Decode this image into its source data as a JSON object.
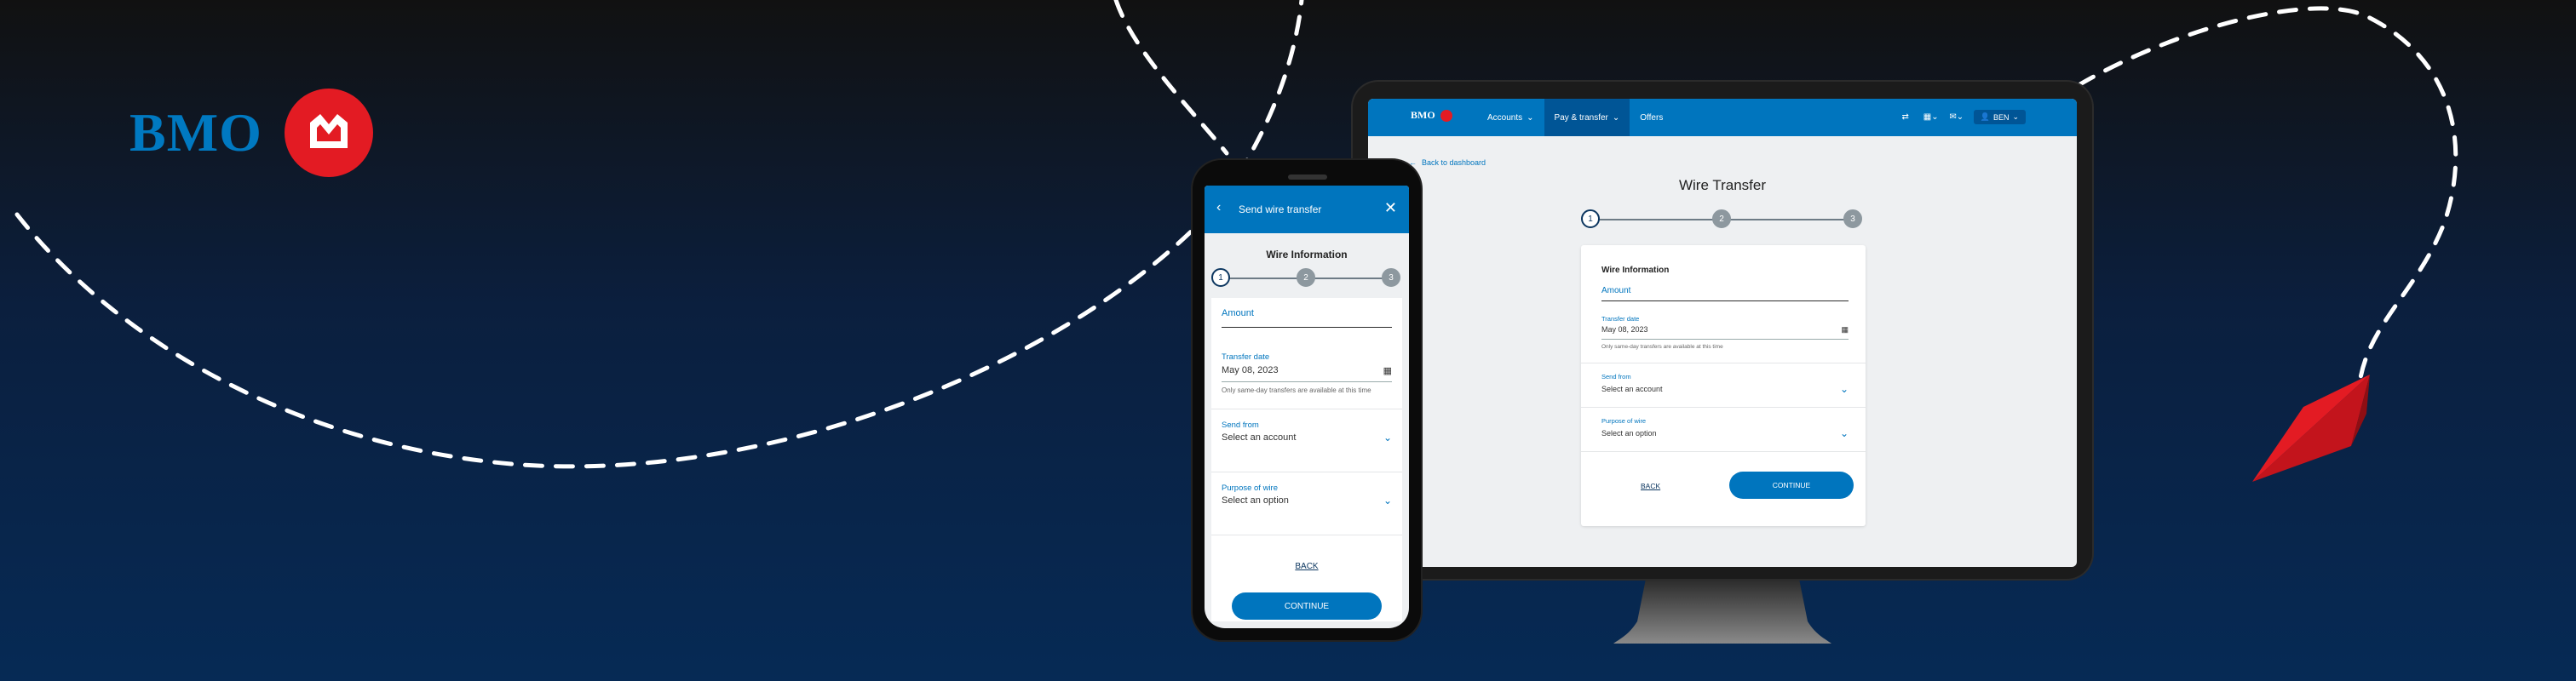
{
  "brand": {
    "name": "BMO",
    "color": "#0079c1",
    "roundel_color": "#e31b23"
  },
  "colors": {
    "primary": "#0075be",
    "nav_active": "#005596",
    "accent_red": "#e31b23",
    "step_done": "#0d3760",
    "step_todo": "#8d989f"
  },
  "desktop": {
    "nav": {
      "logo_text": "BMO",
      "items": [
        {
          "label": "Accounts",
          "has_dropdown": true,
          "active": false
        },
        {
          "label": "Pay & transfer",
          "has_dropdown": true,
          "active": true
        },
        {
          "label": "Offers",
          "has_dropdown": false,
          "active": false
        }
      ],
      "icons": [
        "transfer-icon",
        "bank-icon",
        "mail-icon"
      ],
      "profile_label": "BEN"
    },
    "back_link": "Back to dashboard",
    "title": "Wire Transfer",
    "stepper": {
      "steps": [
        "1",
        "2",
        "3"
      ],
      "current": 1
    },
    "form": {
      "title": "Wire Information",
      "amount_placeholder": "Amount",
      "transfer_date": {
        "label": "Transfer date",
        "value": "May 08, 2023",
        "hint": "Only same-day transfers are available at this time"
      },
      "send_from": {
        "label": "Send from",
        "value": "Select an account"
      },
      "purpose": {
        "label": "Purpose of wire",
        "value": "Select an option"
      },
      "back_label": "BACK",
      "continue_label": "CONTINUE"
    }
  },
  "mobile": {
    "header_title": "Send wire transfer",
    "section_title": "Wire Information",
    "stepper": {
      "steps": [
        "1",
        "2",
        "3"
      ],
      "current": 1
    },
    "form": {
      "amount_placeholder": "Amount",
      "transfer_date": {
        "label": "Transfer date",
        "value": "May 08, 2023",
        "hint": "Only same-day transfers are available at this time"
      },
      "send_from": {
        "label": "Send from",
        "value": "Select an account"
      },
      "purpose": {
        "label": "Purpose of wire",
        "value": "Select an option"
      },
      "back_label": "BACK",
      "continue_label": "CONTINUE"
    }
  }
}
